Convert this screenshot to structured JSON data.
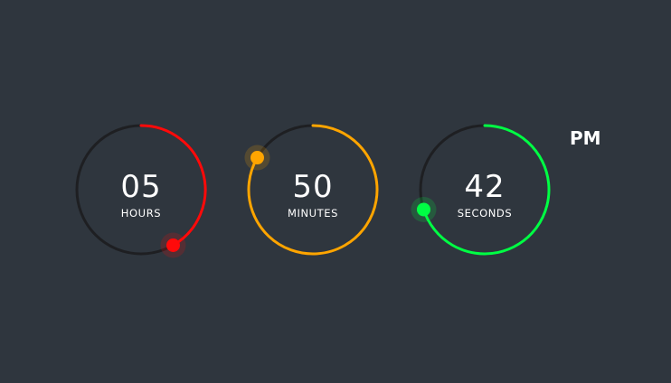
{
  "clock": {
    "dials": [
      {
        "key": "hours",
        "value": "05",
        "label": "HOURS",
        "progress": 0.4167,
        "color": "#ff0a0a"
      },
      {
        "key": "minutes",
        "value": "50",
        "label": "MINUTES",
        "progress": 0.8333,
        "color": "#ffa500"
      },
      {
        "key": "seconds",
        "value": "42",
        "label": "SECONDS",
        "progress": 0.7,
        "color": "#00ff44"
      }
    ],
    "ampm": "PM",
    "track_color": "#1e1f22"
  }
}
